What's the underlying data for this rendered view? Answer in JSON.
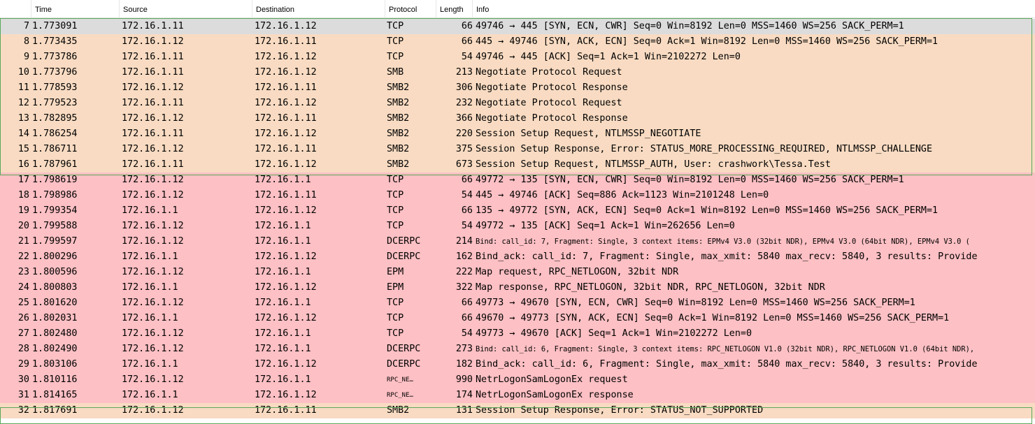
{
  "columns": [
    "Time",
    "Source",
    "Destination",
    "Protocol",
    "Length",
    "Info"
  ],
  "colors": {
    "tcp_row": "#f8dbc2",
    "red_row": "#fdc0c4",
    "selected_row": "#dcdcdc",
    "band_border": "#5aa85a"
  },
  "packets": [
    {
      "no": "7",
      "time": "1.773091",
      "src": "172.16.1.11",
      "dst": "172.16.1.12",
      "proto": "TCP",
      "len": "66",
      "info": "49746 → 445 [SYN, ECN, CWR] Seq=0 Win=8192 Len=0 MSS=1460 WS=256 SACK_PERM=1",
      "color": "selected"
    },
    {
      "no": "8",
      "time": "1.773435",
      "src": "172.16.1.12",
      "dst": "172.16.1.11",
      "proto": "TCP",
      "len": "66",
      "info": "445 → 49746 [SYN, ACK, ECN] Seq=0 Ack=1 Win=8192 Len=0 MSS=1460 WS=256 SACK_PERM=1",
      "color": "tcp"
    },
    {
      "no": "9",
      "time": "1.773786",
      "src": "172.16.1.11",
      "dst": "172.16.1.12",
      "proto": "TCP",
      "len": "54",
      "info": "49746 → 445 [ACK] Seq=1 Ack=1 Win=2102272 Len=0",
      "color": "tcp"
    },
    {
      "no": "10",
      "time": "1.773796",
      "src": "172.16.1.11",
      "dst": "172.16.1.12",
      "proto": "SMB",
      "len": "213",
      "info": "Negotiate Protocol Request",
      "color": "tcp"
    },
    {
      "no": "11",
      "time": "1.778593",
      "src": "172.16.1.12",
      "dst": "172.16.1.11",
      "proto": "SMB2",
      "len": "306",
      "info": "Negotiate Protocol Response",
      "color": "tcp"
    },
    {
      "no": "12",
      "time": "1.779523",
      "src": "172.16.1.11",
      "dst": "172.16.1.12",
      "proto": "SMB2",
      "len": "232",
      "info": "Negotiate Protocol Request",
      "color": "tcp"
    },
    {
      "no": "13",
      "time": "1.782895",
      "src": "172.16.1.12",
      "dst": "172.16.1.11",
      "proto": "SMB2",
      "len": "366",
      "info": "Negotiate Protocol Response",
      "color": "tcp"
    },
    {
      "no": "14",
      "time": "1.786254",
      "src": "172.16.1.11",
      "dst": "172.16.1.12",
      "proto": "SMB2",
      "len": "220",
      "info": "Session Setup Request, NTLMSSP_NEGOTIATE",
      "color": "tcp"
    },
    {
      "no": "15",
      "time": "1.786711",
      "src": "172.16.1.12",
      "dst": "172.16.1.11",
      "proto": "SMB2",
      "len": "375",
      "info": "Session Setup Response, Error: STATUS_MORE_PROCESSING_REQUIRED, NTLMSSP_CHALLENGE",
      "color": "tcp"
    },
    {
      "no": "16",
      "time": "1.787961",
      "src": "172.16.1.11",
      "dst": "172.16.1.12",
      "proto": "SMB2",
      "len": "673",
      "info": "Session Setup Request, NTLMSSP_AUTH, User: crashwork\\Tessa.Test",
      "color": "tcp"
    },
    {
      "no": "17",
      "time": "1.798619",
      "src": "172.16.1.12",
      "dst": "172.16.1.1",
      "proto": "TCP",
      "len": "66",
      "info": "49772 → 135 [SYN, ECN, CWR] Seq=0 Win=8192 Len=0 MSS=1460 WS=256 SACK_PERM=1",
      "color": "red"
    },
    {
      "no": "18",
      "time": "1.798986",
      "src": "172.16.1.12",
      "dst": "172.16.1.11",
      "proto": "TCP",
      "len": "54",
      "info": "445 → 49746 [ACK] Seq=886 Ack=1123 Win=2101248 Len=0",
      "color": "red"
    },
    {
      "no": "19",
      "time": "1.799354",
      "src": "172.16.1.1",
      "dst": "172.16.1.12",
      "proto": "TCP",
      "len": "66",
      "info": "135 → 49772 [SYN, ACK, ECN] Seq=0 Ack=1 Win=8192 Len=0 MSS=1460 WS=256 SACK_PERM=1",
      "color": "red"
    },
    {
      "no": "20",
      "time": "1.799588",
      "src": "172.16.1.12",
      "dst": "172.16.1.1",
      "proto": "TCP",
      "len": "54",
      "info": "49772 → 135 [ACK] Seq=1 Ack=1 Win=262656 Len=0",
      "color": "red"
    },
    {
      "no": "21",
      "time": "1.799597",
      "src": "172.16.1.12",
      "dst": "172.16.1.1",
      "proto": "DCERPC",
      "len": "214",
      "info": "Bind: call_id: 7, Fragment: Single, 3 context items: EPMv4 V3.0 (32bit NDR), EPMv4 V3.0 (64bit NDR), EPMv4 V3.0 (",
      "color": "red",
      "small": true
    },
    {
      "no": "22",
      "time": "1.800296",
      "src": "172.16.1.1",
      "dst": "172.16.1.12",
      "proto": "DCERPC",
      "len": "162",
      "info": "Bind_ack: call_id: 7, Fragment: Single, max_xmit: 5840 max_recv: 5840, 3 results: Provide",
      "color": "red"
    },
    {
      "no": "23",
      "time": "1.800596",
      "src": "172.16.1.12",
      "dst": "172.16.1.1",
      "proto": "EPM",
      "len": "222",
      "info": "Map request, RPC_NETLOGON, 32bit NDR",
      "color": "red"
    },
    {
      "no": "24",
      "time": "1.800803",
      "src": "172.16.1.1",
      "dst": "172.16.1.12",
      "proto": "EPM",
      "len": "322",
      "info": "Map response, RPC_NETLOGON, 32bit NDR, RPC_NETLOGON, 32bit NDR",
      "color": "red"
    },
    {
      "no": "25",
      "time": "1.801620",
      "src": "172.16.1.12",
      "dst": "172.16.1.1",
      "proto": "TCP",
      "len": "66",
      "info": "49773 → 49670 [SYN, ECN, CWR] Seq=0 Win=8192 Len=0 MSS=1460 WS=256 SACK_PERM=1",
      "color": "red"
    },
    {
      "no": "26",
      "time": "1.802031",
      "src": "172.16.1.1",
      "dst": "172.16.1.12",
      "proto": "TCP",
      "len": "66",
      "info": "49670 → 49773 [SYN, ACK, ECN] Seq=0 Ack=1 Win=8192 Len=0 MSS=1460 WS=256 SACK_PERM=1",
      "color": "red"
    },
    {
      "no": "27",
      "time": "1.802480",
      "src": "172.16.1.12",
      "dst": "172.16.1.1",
      "proto": "TCP",
      "len": "54",
      "info": "49773 → 49670 [ACK] Seq=1 Ack=1 Win=2102272 Len=0",
      "color": "red"
    },
    {
      "no": "28",
      "time": "1.802490",
      "src": "172.16.1.12",
      "dst": "172.16.1.1",
      "proto": "DCERPC",
      "len": "273",
      "info": "Bind: call_id: 6, Fragment: Single, 3 context items: RPC_NETLOGON V1.0 (32bit NDR), RPC_NETLOGON V1.0 (64bit NDR),",
      "color": "red",
      "small": true
    },
    {
      "no": "29",
      "time": "1.803106",
      "src": "172.16.1.1",
      "dst": "172.16.1.12",
      "proto": "DCERPC",
      "len": "182",
      "info": "Bind_ack: call_id: 6, Fragment: Single, max_xmit: 5840 max_recv: 5840, 3 results: Provide",
      "color": "red"
    },
    {
      "no": "30",
      "time": "1.810116",
      "src": "172.16.1.12",
      "dst": "172.16.1.1",
      "proto": "RPC_NE…",
      "len": "990",
      "info": "NetrLogonSamLogonEx request",
      "color": "red",
      "tinyproto": true
    },
    {
      "no": "31",
      "time": "1.814165",
      "src": "172.16.1.1",
      "dst": "172.16.1.12",
      "proto": "RPC_NE…",
      "len": "174",
      "info": "NetrLogonSamLogonEx response",
      "color": "red",
      "tinyproto": true
    },
    {
      "no": "32",
      "time": "1.817691",
      "src": "172.16.1.12",
      "dst": "172.16.1.11",
      "proto": "SMB2",
      "len": "131",
      "info": "Session Setup Response, Error: STATUS_NOT_SUPPORTED",
      "color": "tcp"
    }
  ]
}
